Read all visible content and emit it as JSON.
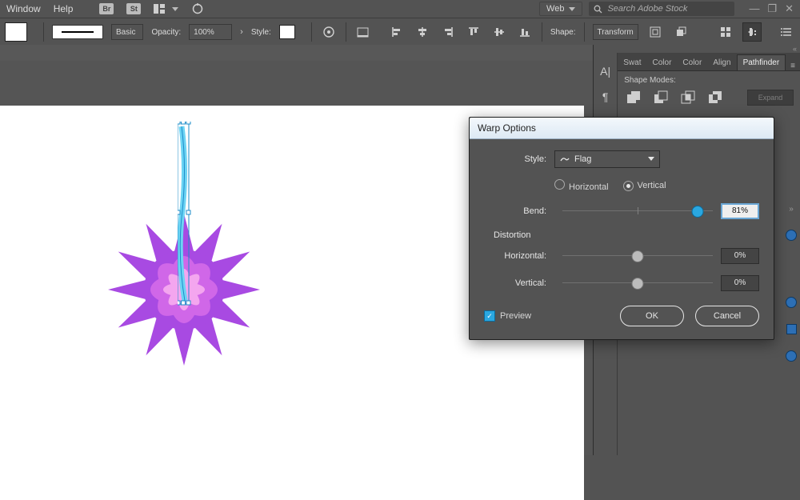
{
  "menu": {
    "window": "Window",
    "help": "Help",
    "br": "Br",
    "st": "St"
  },
  "workspace": {
    "label": "Web"
  },
  "search": {
    "placeholder": "Search Adobe Stock"
  },
  "optionsbar": {
    "profile_label": "Basic",
    "opacity_label": "Opacity:",
    "opacity_value": "100%",
    "style_label": "Style:",
    "shape_label": "Shape:",
    "transform_label": "Transform"
  },
  "panels": {
    "tabs": {
      "swatches": "Swat",
      "color1": "Color",
      "color2": "Color",
      "align": "Align",
      "pathfinder": "Pathfinder"
    },
    "shape_modes_label": "Shape Modes:",
    "expand_label": "Expand"
  },
  "dialog": {
    "title": "Warp Options",
    "style_label": "Style:",
    "style_value": "Flag",
    "orient_h": "Horizontal",
    "orient_v": "Vertical",
    "bend_label": "Bend:",
    "bend_value": "81%",
    "distortion_label": "Distortion",
    "dh_label": "Horizontal:",
    "dh_value": "0%",
    "dv_label": "Vertical:",
    "dv_value": "0%",
    "preview_label": "Preview",
    "ok": "OK",
    "cancel": "Cancel"
  }
}
